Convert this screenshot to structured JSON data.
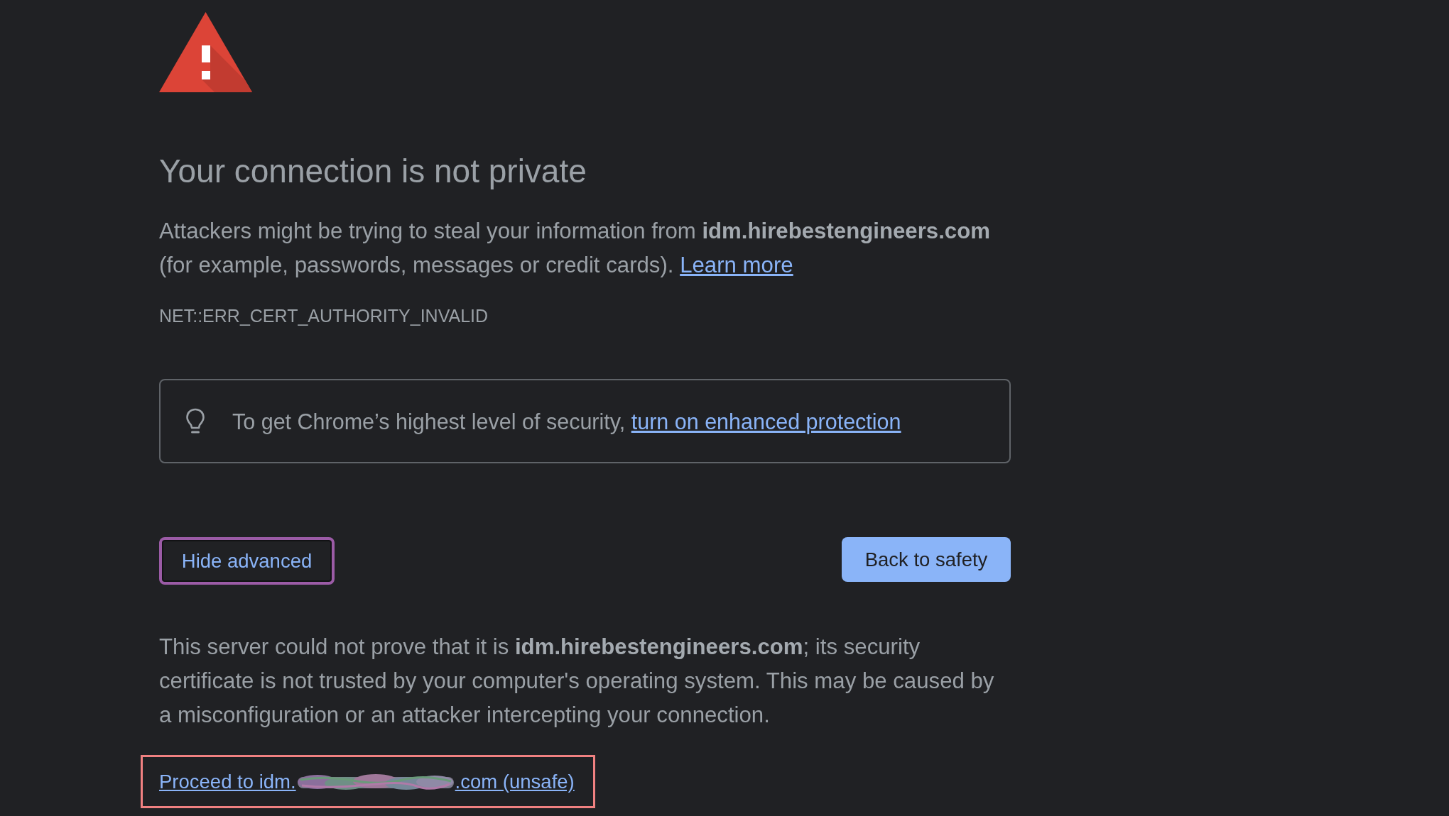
{
  "heading": "Your connection is not private",
  "main_message": {
    "text": "Attackers might be trying to steal your information from **idm.hirebestengineers.com** (for example, passwords, messages or credit cards).",
    "link": "Learn more"
  },
  "error_code": "NET::ERR_CERT_AUTHORITY_INVALID",
  "enhanced_protection": {
    "text": "To get Chrome’s highest level of security,",
    "link": "turn on enhanced protection"
  },
  "buttons": [
    {
      "label": "Hide advanced",
      "kind": "secondary",
      "focused": true
    },
    {
      "label": "Back to safety",
      "kind": "primary",
      "focused": false
    }
  ],
  "details": "This server could not prove that it is **idm.hirebestengineers.com**; its security certificate is not trusted by your computer's operating system. This may be caused by a misconfiguration or an attacker intercepting your connection.",
  "proceed_link": {
    "text_before": "Proceed to idm.",
    "redacted": true,
    "text_after": ".com (unsafe)",
    "highlighted": true
  }
}
